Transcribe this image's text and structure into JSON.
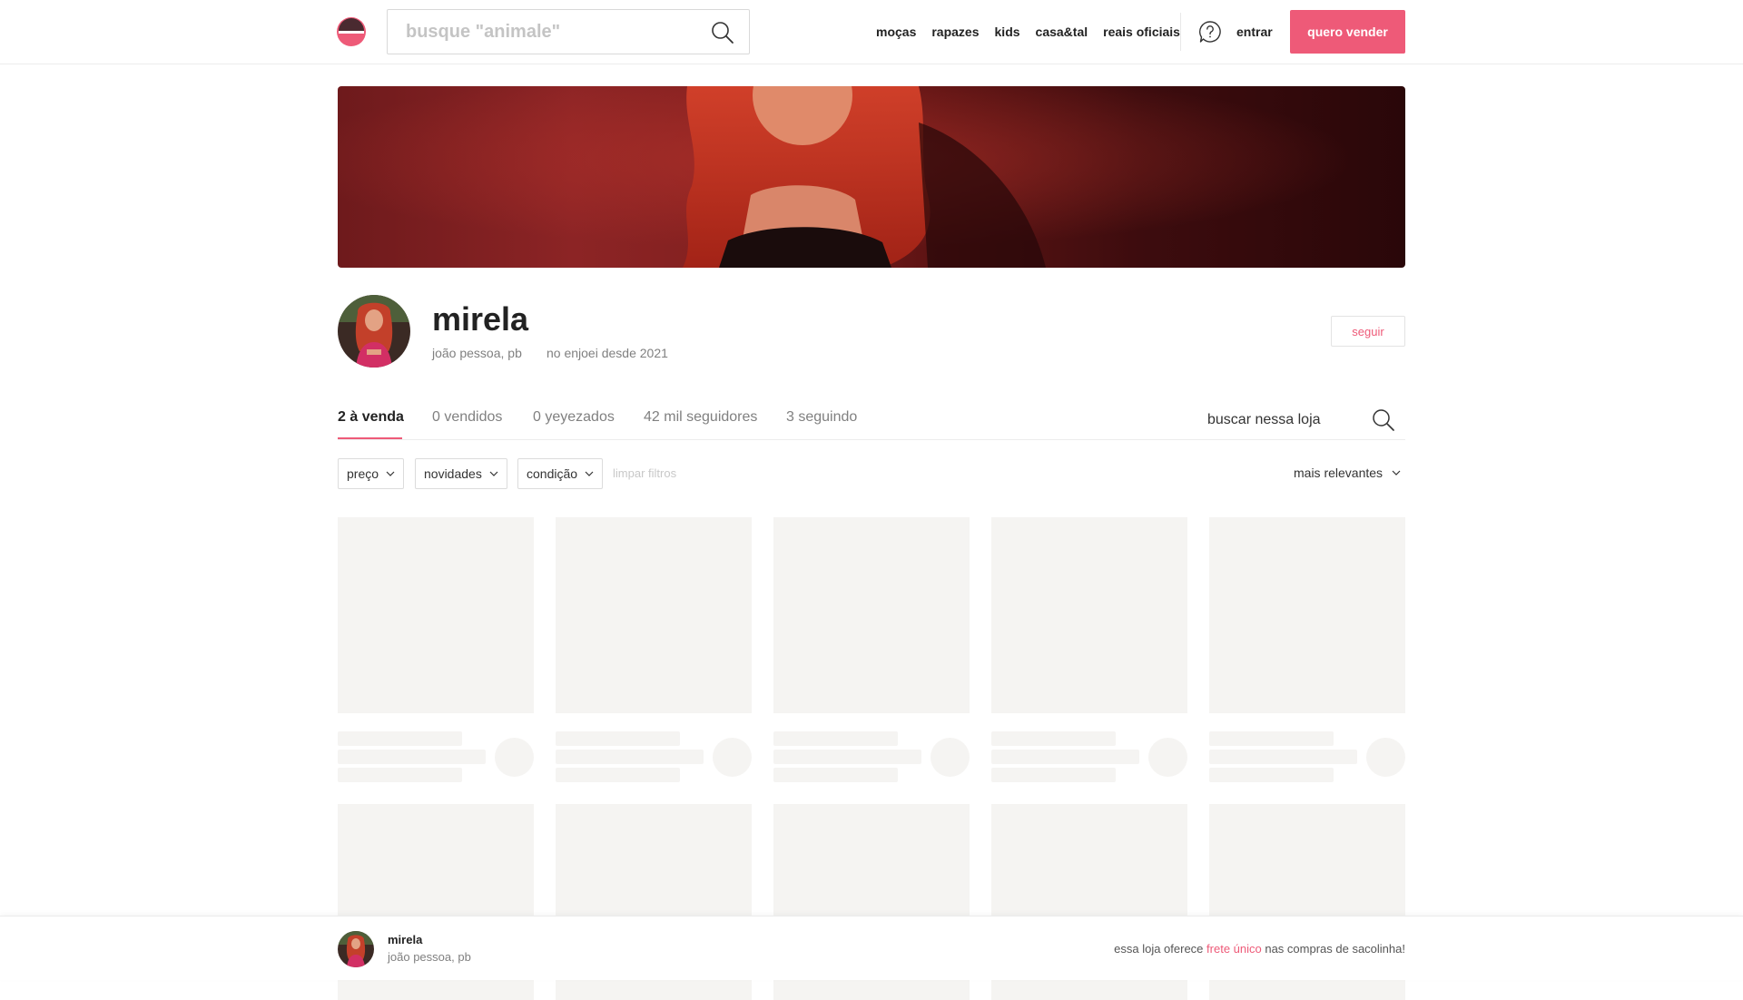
{
  "header": {
    "search_placeholder": "busque \"animale\"",
    "nav": [
      "moças",
      "rapazes",
      "kids",
      "casa&tal",
      "reais oficiais"
    ],
    "login_label": "entrar",
    "sell_label": "quero vender"
  },
  "profile": {
    "name": "mirela",
    "location": "joão pessoa, pb",
    "since": "no enjoei desde 2021",
    "follow_label": "seguir"
  },
  "tabs": [
    "2 à venda",
    "0 vendidos",
    "0 yeyezados",
    "42 mil seguidores",
    "3 seguindo"
  ],
  "store_search_placeholder": "buscar nessa loja",
  "filters": {
    "price": "preço",
    "news": "novidades",
    "condition": "condição",
    "clear": "limpar filtros",
    "sort": "mais relevantes"
  },
  "footer": {
    "name": "mirela",
    "location": "joão pessoa, pb",
    "msg_before": "essa loja oferece ",
    "msg_highlight": "frete único",
    "msg_after": " nas compras de sacolinha!"
  },
  "colors": {
    "accent": "#ee5a78",
    "skeleton": "#f5f4f2"
  }
}
